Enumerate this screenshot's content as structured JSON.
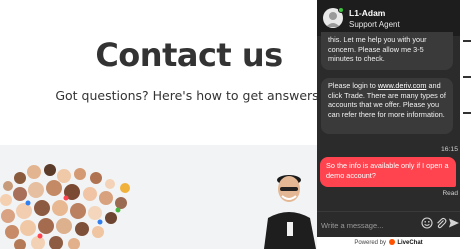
{
  "page": {
    "title": "Contact us",
    "subtitle": "Got questions? Here's how to get answers."
  },
  "chat": {
    "agent": {
      "name": "L1-Adam",
      "role": "Support Agent",
      "status": "online"
    },
    "messages": {
      "agent_1": "this. Let me help you with your concern. Please allow me 3-5 minutes to check.",
      "agent_2_before_link": "Please login to ",
      "agent_2_link": "www.deriv.com",
      "agent_2_after_link": " and click Trade. There are many types of accounts that we offer. Please you can refer there for more information.",
      "timestamp": "16:15",
      "user_1": "So the info is available only if I open a demo account?",
      "read_receipt": "Read"
    },
    "input": {
      "placeholder": "Write a message..."
    },
    "icons": [
      "emoji-icon",
      "attach-icon",
      "send-icon"
    ],
    "footer": {
      "prefix": "Powered by",
      "brand": "LiveChat"
    }
  },
  "colors": {
    "user_bubble": "#ff444f",
    "chat_background": "#2b2b2b",
    "agent_bubble": "#3a3a3a",
    "online": "#3ec33e",
    "livechat_brand": "#ff5100"
  }
}
